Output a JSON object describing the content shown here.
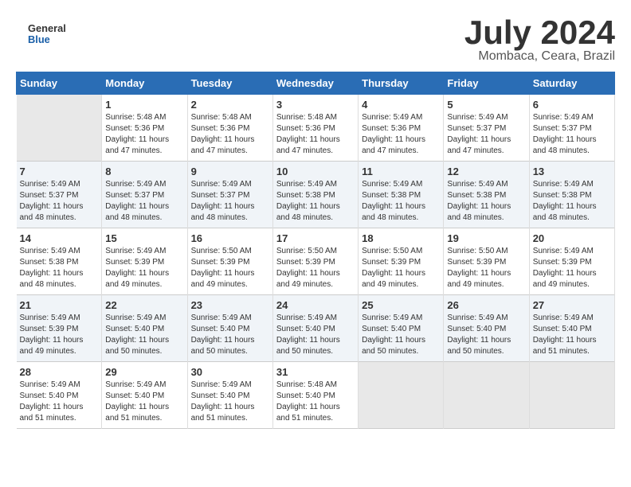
{
  "header": {
    "logo_line1": "General",
    "logo_line2": "Blue",
    "title": "July 2024",
    "subtitle": "Mombaca, Ceara, Brazil"
  },
  "days_of_week": [
    "Sunday",
    "Monday",
    "Tuesday",
    "Wednesday",
    "Thursday",
    "Friday",
    "Saturday"
  ],
  "weeks": [
    [
      {
        "day": "",
        "info": ""
      },
      {
        "day": "1",
        "info": "Sunrise: 5:48 AM\nSunset: 5:36 PM\nDaylight: 11 hours\nand 47 minutes."
      },
      {
        "day": "2",
        "info": "Sunrise: 5:48 AM\nSunset: 5:36 PM\nDaylight: 11 hours\nand 47 minutes."
      },
      {
        "day": "3",
        "info": "Sunrise: 5:48 AM\nSunset: 5:36 PM\nDaylight: 11 hours\nand 47 minutes."
      },
      {
        "day": "4",
        "info": "Sunrise: 5:49 AM\nSunset: 5:36 PM\nDaylight: 11 hours\nand 47 minutes."
      },
      {
        "day": "5",
        "info": "Sunrise: 5:49 AM\nSunset: 5:37 PM\nDaylight: 11 hours\nand 47 minutes."
      },
      {
        "day": "6",
        "info": "Sunrise: 5:49 AM\nSunset: 5:37 PM\nDaylight: 11 hours\nand 48 minutes."
      }
    ],
    [
      {
        "day": "7",
        "info": "Sunrise: 5:49 AM\nSunset: 5:37 PM\nDaylight: 11 hours\nand 48 minutes."
      },
      {
        "day": "8",
        "info": "Sunrise: 5:49 AM\nSunset: 5:37 PM\nDaylight: 11 hours\nand 48 minutes."
      },
      {
        "day": "9",
        "info": "Sunrise: 5:49 AM\nSunset: 5:37 PM\nDaylight: 11 hours\nand 48 minutes."
      },
      {
        "day": "10",
        "info": "Sunrise: 5:49 AM\nSunset: 5:38 PM\nDaylight: 11 hours\nand 48 minutes."
      },
      {
        "day": "11",
        "info": "Sunrise: 5:49 AM\nSunset: 5:38 PM\nDaylight: 11 hours\nand 48 minutes."
      },
      {
        "day": "12",
        "info": "Sunrise: 5:49 AM\nSunset: 5:38 PM\nDaylight: 11 hours\nand 48 minutes."
      },
      {
        "day": "13",
        "info": "Sunrise: 5:49 AM\nSunset: 5:38 PM\nDaylight: 11 hours\nand 48 minutes."
      }
    ],
    [
      {
        "day": "14",
        "info": "Sunrise: 5:49 AM\nSunset: 5:38 PM\nDaylight: 11 hours\nand 48 minutes."
      },
      {
        "day": "15",
        "info": "Sunrise: 5:49 AM\nSunset: 5:39 PM\nDaylight: 11 hours\nand 49 minutes."
      },
      {
        "day": "16",
        "info": "Sunrise: 5:50 AM\nSunset: 5:39 PM\nDaylight: 11 hours\nand 49 minutes."
      },
      {
        "day": "17",
        "info": "Sunrise: 5:50 AM\nSunset: 5:39 PM\nDaylight: 11 hours\nand 49 minutes."
      },
      {
        "day": "18",
        "info": "Sunrise: 5:50 AM\nSunset: 5:39 PM\nDaylight: 11 hours\nand 49 minutes."
      },
      {
        "day": "19",
        "info": "Sunrise: 5:50 AM\nSunset: 5:39 PM\nDaylight: 11 hours\nand 49 minutes."
      },
      {
        "day": "20",
        "info": "Sunrise: 5:49 AM\nSunset: 5:39 PM\nDaylight: 11 hours\nand 49 minutes."
      }
    ],
    [
      {
        "day": "21",
        "info": "Sunrise: 5:49 AM\nSunset: 5:39 PM\nDaylight: 11 hours\nand 49 minutes."
      },
      {
        "day": "22",
        "info": "Sunrise: 5:49 AM\nSunset: 5:40 PM\nDaylight: 11 hours\nand 50 minutes."
      },
      {
        "day": "23",
        "info": "Sunrise: 5:49 AM\nSunset: 5:40 PM\nDaylight: 11 hours\nand 50 minutes."
      },
      {
        "day": "24",
        "info": "Sunrise: 5:49 AM\nSunset: 5:40 PM\nDaylight: 11 hours\nand 50 minutes."
      },
      {
        "day": "25",
        "info": "Sunrise: 5:49 AM\nSunset: 5:40 PM\nDaylight: 11 hours\nand 50 minutes."
      },
      {
        "day": "26",
        "info": "Sunrise: 5:49 AM\nSunset: 5:40 PM\nDaylight: 11 hours\nand 50 minutes."
      },
      {
        "day": "27",
        "info": "Sunrise: 5:49 AM\nSunset: 5:40 PM\nDaylight: 11 hours\nand 51 minutes."
      }
    ],
    [
      {
        "day": "28",
        "info": "Sunrise: 5:49 AM\nSunset: 5:40 PM\nDaylight: 11 hours\nand 51 minutes."
      },
      {
        "day": "29",
        "info": "Sunrise: 5:49 AM\nSunset: 5:40 PM\nDaylight: 11 hours\nand 51 minutes."
      },
      {
        "day": "30",
        "info": "Sunrise: 5:49 AM\nSunset: 5:40 PM\nDaylight: 11 hours\nand 51 minutes."
      },
      {
        "day": "31",
        "info": "Sunrise: 5:48 AM\nSunset: 5:40 PM\nDaylight: 11 hours\nand 51 minutes."
      },
      {
        "day": "",
        "info": ""
      },
      {
        "day": "",
        "info": ""
      },
      {
        "day": "",
        "info": ""
      }
    ]
  ]
}
